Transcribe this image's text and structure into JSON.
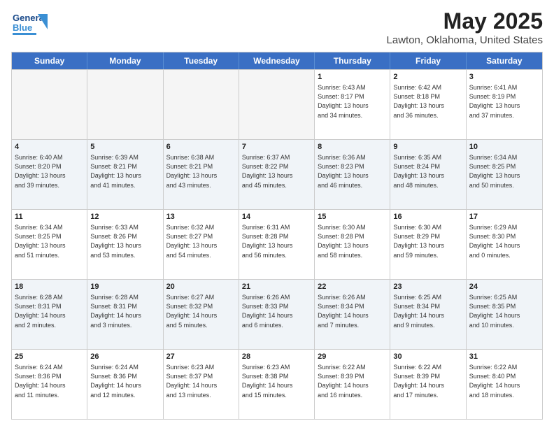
{
  "header": {
    "logo_general": "General",
    "logo_blue": "Blue",
    "title": "May 2025",
    "subtitle": "Lawton, Oklahoma, United States"
  },
  "days": [
    "Sunday",
    "Monday",
    "Tuesday",
    "Wednesday",
    "Thursday",
    "Friday",
    "Saturday"
  ],
  "weeks": [
    [
      {
        "num": "",
        "info": ""
      },
      {
        "num": "",
        "info": ""
      },
      {
        "num": "",
        "info": ""
      },
      {
        "num": "",
        "info": ""
      },
      {
        "num": "1",
        "info": "Sunrise: 6:43 AM\nSunset: 8:17 PM\nDaylight: 13 hours\nand 34 minutes."
      },
      {
        "num": "2",
        "info": "Sunrise: 6:42 AM\nSunset: 8:18 PM\nDaylight: 13 hours\nand 36 minutes."
      },
      {
        "num": "3",
        "info": "Sunrise: 6:41 AM\nSunset: 8:19 PM\nDaylight: 13 hours\nand 37 minutes."
      }
    ],
    [
      {
        "num": "4",
        "info": "Sunrise: 6:40 AM\nSunset: 8:20 PM\nDaylight: 13 hours\nand 39 minutes."
      },
      {
        "num": "5",
        "info": "Sunrise: 6:39 AM\nSunset: 8:21 PM\nDaylight: 13 hours\nand 41 minutes."
      },
      {
        "num": "6",
        "info": "Sunrise: 6:38 AM\nSunset: 8:21 PM\nDaylight: 13 hours\nand 43 minutes."
      },
      {
        "num": "7",
        "info": "Sunrise: 6:37 AM\nSunset: 8:22 PM\nDaylight: 13 hours\nand 45 minutes."
      },
      {
        "num": "8",
        "info": "Sunrise: 6:36 AM\nSunset: 8:23 PM\nDaylight: 13 hours\nand 46 minutes."
      },
      {
        "num": "9",
        "info": "Sunrise: 6:35 AM\nSunset: 8:24 PM\nDaylight: 13 hours\nand 48 minutes."
      },
      {
        "num": "10",
        "info": "Sunrise: 6:34 AM\nSunset: 8:25 PM\nDaylight: 13 hours\nand 50 minutes."
      }
    ],
    [
      {
        "num": "11",
        "info": "Sunrise: 6:34 AM\nSunset: 8:25 PM\nDaylight: 13 hours\nand 51 minutes."
      },
      {
        "num": "12",
        "info": "Sunrise: 6:33 AM\nSunset: 8:26 PM\nDaylight: 13 hours\nand 53 minutes."
      },
      {
        "num": "13",
        "info": "Sunrise: 6:32 AM\nSunset: 8:27 PM\nDaylight: 13 hours\nand 54 minutes."
      },
      {
        "num": "14",
        "info": "Sunrise: 6:31 AM\nSunset: 8:28 PM\nDaylight: 13 hours\nand 56 minutes."
      },
      {
        "num": "15",
        "info": "Sunrise: 6:30 AM\nSunset: 8:28 PM\nDaylight: 13 hours\nand 58 minutes."
      },
      {
        "num": "16",
        "info": "Sunrise: 6:30 AM\nSunset: 8:29 PM\nDaylight: 13 hours\nand 59 minutes."
      },
      {
        "num": "17",
        "info": "Sunrise: 6:29 AM\nSunset: 8:30 PM\nDaylight: 14 hours\nand 0 minutes."
      }
    ],
    [
      {
        "num": "18",
        "info": "Sunrise: 6:28 AM\nSunset: 8:31 PM\nDaylight: 14 hours\nand 2 minutes."
      },
      {
        "num": "19",
        "info": "Sunrise: 6:28 AM\nSunset: 8:31 PM\nDaylight: 14 hours\nand 3 minutes."
      },
      {
        "num": "20",
        "info": "Sunrise: 6:27 AM\nSunset: 8:32 PM\nDaylight: 14 hours\nand 5 minutes."
      },
      {
        "num": "21",
        "info": "Sunrise: 6:26 AM\nSunset: 8:33 PM\nDaylight: 14 hours\nand 6 minutes."
      },
      {
        "num": "22",
        "info": "Sunrise: 6:26 AM\nSunset: 8:34 PM\nDaylight: 14 hours\nand 7 minutes."
      },
      {
        "num": "23",
        "info": "Sunrise: 6:25 AM\nSunset: 8:34 PM\nDaylight: 14 hours\nand 9 minutes."
      },
      {
        "num": "24",
        "info": "Sunrise: 6:25 AM\nSunset: 8:35 PM\nDaylight: 14 hours\nand 10 minutes."
      }
    ],
    [
      {
        "num": "25",
        "info": "Sunrise: 6:24 AM\nSunset: 8:36 PM\nDaylight: 14 hours\nand 11 minutes."
      },
      {
        "num": "26",
        "info": "Sunrise: 6:24 AM\nSunset: 8:36 PM\nDaylight: 14 hours\nand 12 minutes."
      },
      {
        "num": "27",
        "info": "Sunrise: 6:23 AM\nSunset: 8:37 PM\nDaylight: 14 hours\nand 13 minutes."
      },
      {
        "num": "28",
        "info": "Sunrise: 6:23 AM\nSunset: 8:38 PM\nDaylight: 14 hours\nand 15 minutes."
      },
      {
        "num": "29",
        "info": "Sunrise: 6:22 AM\nSunset: 8:39 PM\nDaylight: 14 hours\nand 16 minutes."
      },
      {
        "num": "30",
        "info": "Sunrise: 6:22 AM\nSunset: 8:39 PM\nDaylight: 14 hours\nand 17 minutes."
      },
      {
        "num": "31",
        "info": "Sunrise: 6:22 AM\nSunset: 8:40 PM\nDaylight: 14 hours\nand 18 minutes."
      }
    ]
  ]
}
